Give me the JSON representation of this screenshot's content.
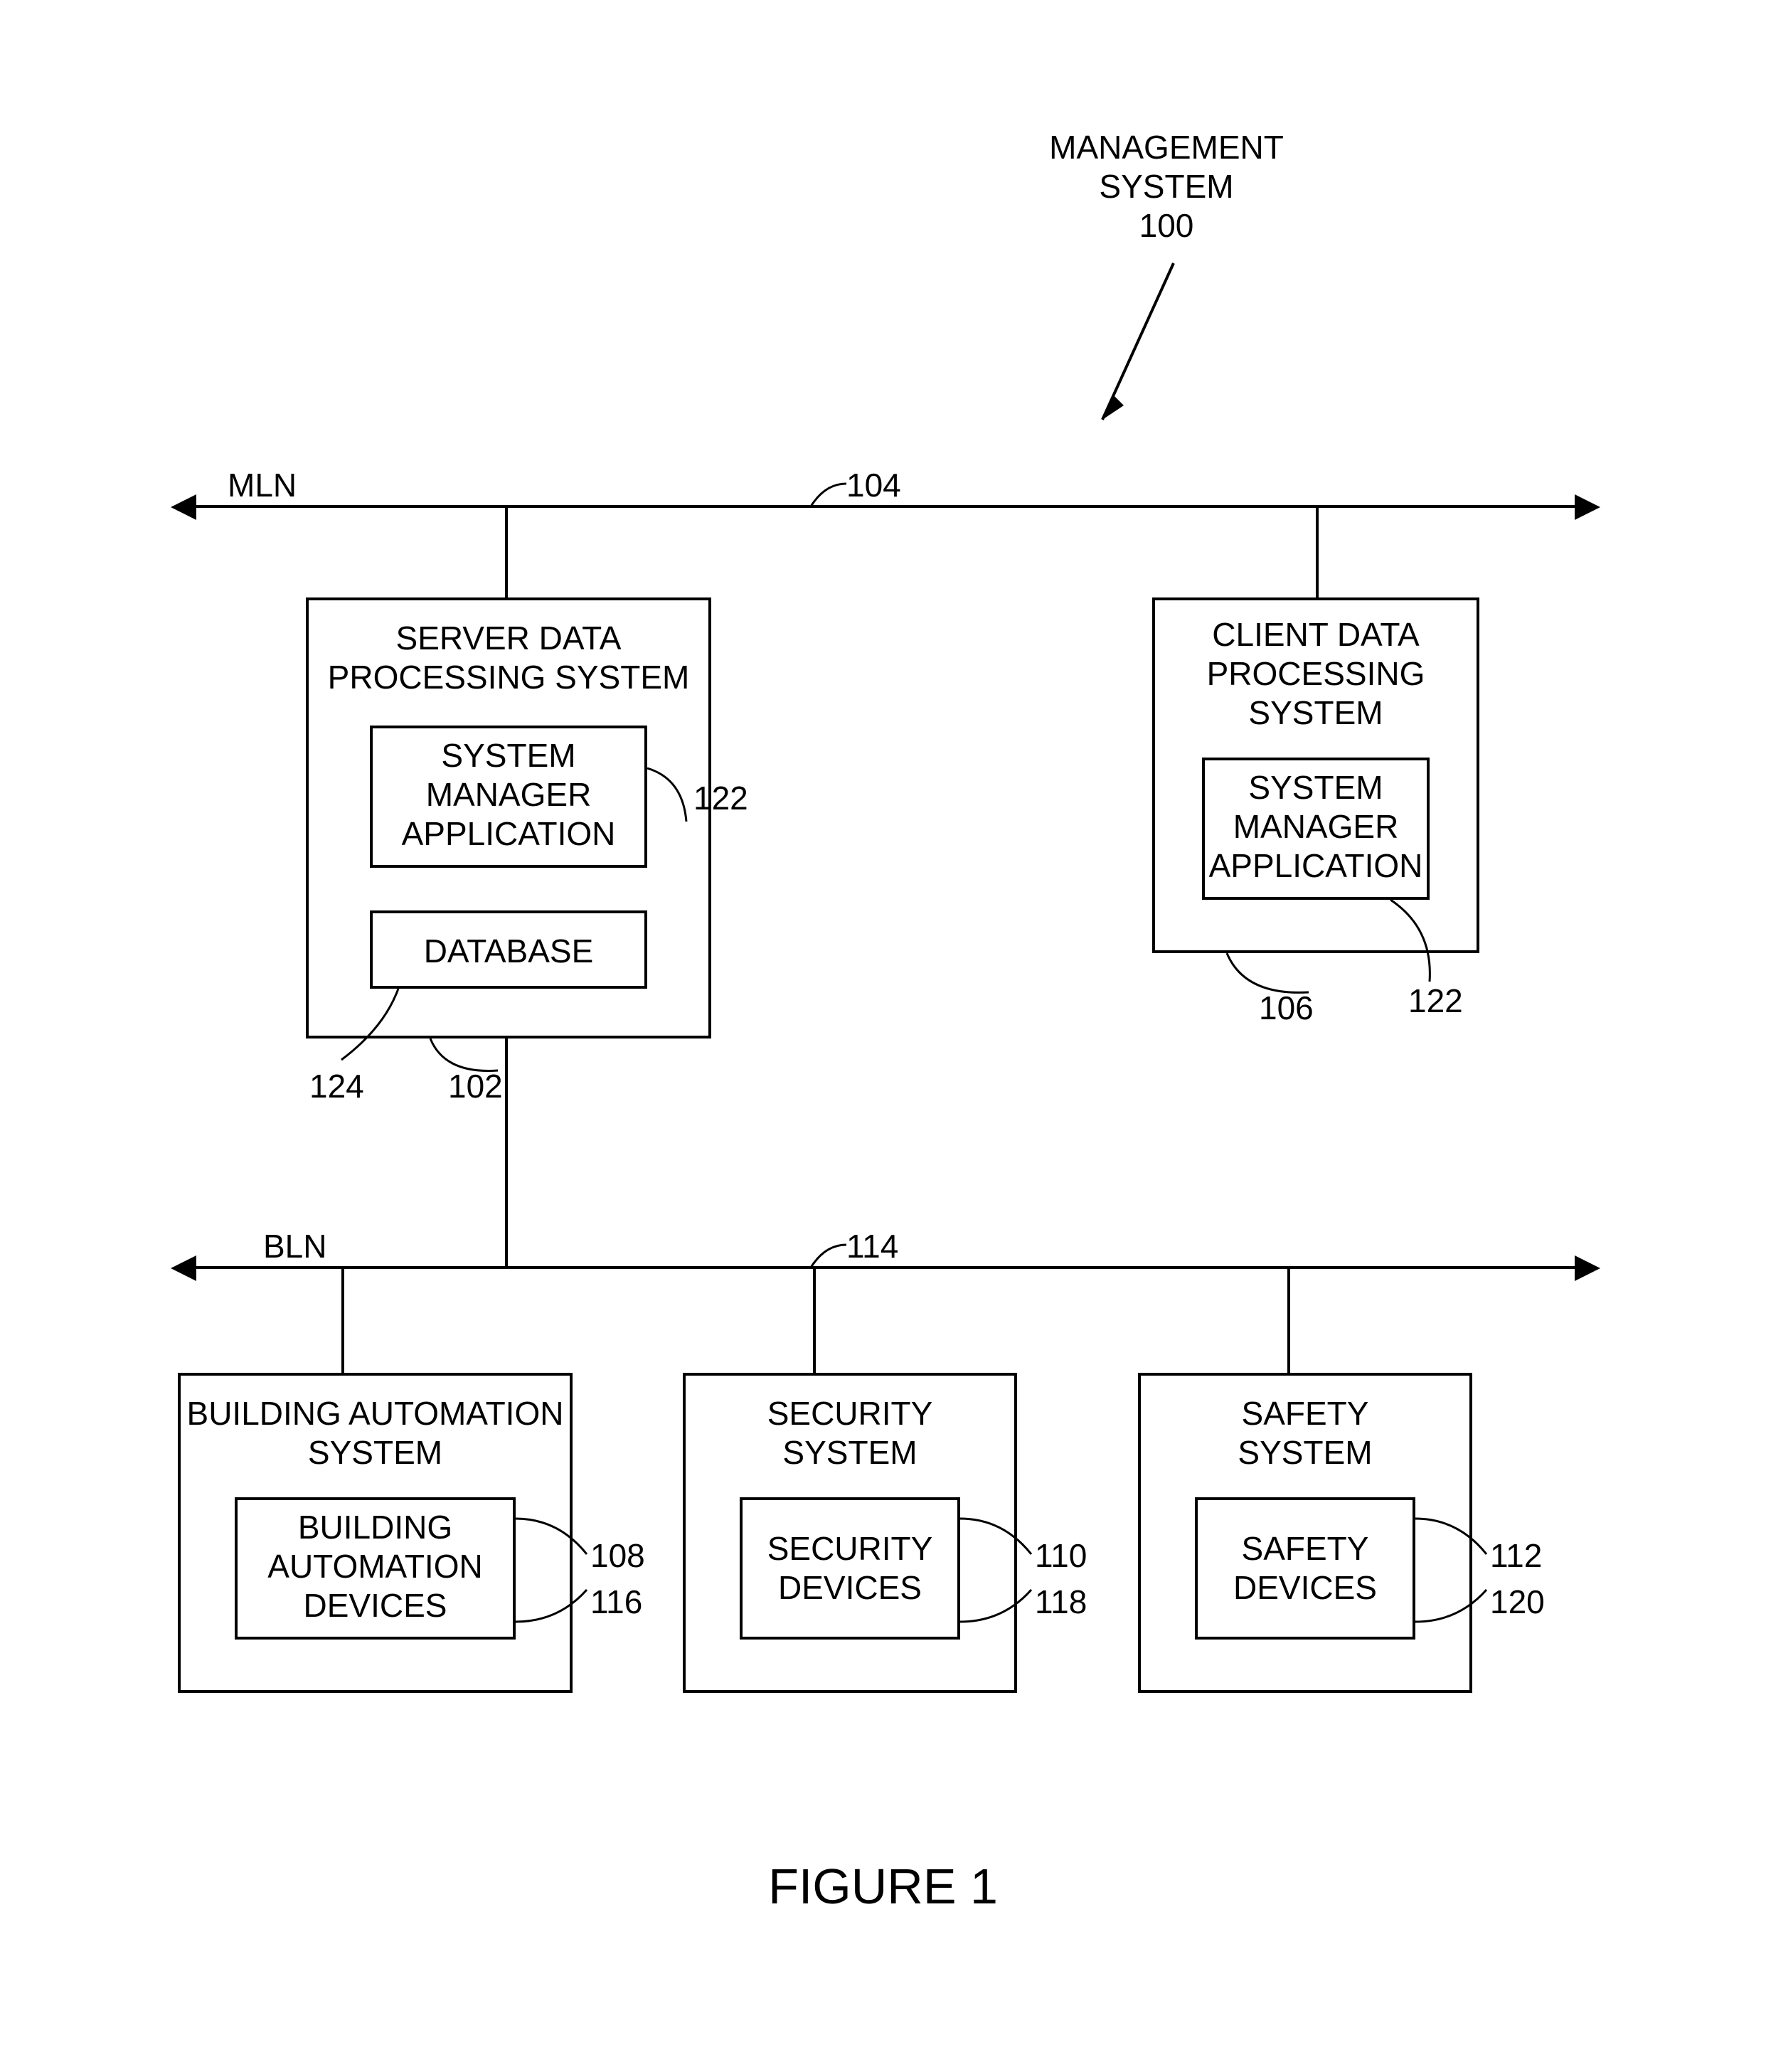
{
  "title": {
    "line1": "MANAGEMENT",
    "line2": "SYSTEM",
    "ref": "100"
  },
  "bus_mln": {
    "label": "MLN",
    "ref": "104"
  },
  "bus_bln": {
    "label": "BLN",
    "ref": "114"
  },
  "server": {
    "title_l1": "SERVER DATA",
    "title_l2": "PROCESSING SYSTEM",
    "app_l1": "SYSTEM",
    "app_l2": "MANAGER",
    "app_l3": "APPLICATION",
    "db": "DATABASE",
    "ref_app": "122",
    "ref_db": "124",
    "ref_box": "102"
  },
  "client": {
    "title_l1": "CLIENT DATA",
    "title_l2": "PROCESSING",
    "title_l3": "SYSTEM",
    "app_l1": "SYSTEM",
    "app_l2": "MANAGER",
    "app_l3": "APPLICATION",
    "ref_app": "122",
    "ref_box": "106"
  },
  "bas": {
    "title_l1": "BUILDING AUTOMATION",
    "title_l2": "SYSTEM",
    "dev_l1": "BUILDING",
    "dev_l2": "AUTOMATION",
    "dev_l3": "DEVICES",
    "ref_box": "108",
    "ref_dev": "116"
  },
  "security": {
    "title_l1": "SECURITY",
    "title_l2": "SYSTEM",
    "dev_l1": "SECURITY",
    "dev_l2": "DEVICES",
    "ref_box": "110",
    "ref_dev": "118"
  },
  "safety": {
    "title_l1": "SAFETY",
    "title_l2": "SYSTEM",
    "dev_l1": "SAFETY",
    "dev_l2": "DEVICES",
    "ref_box": "112",
    "ref_dev": "120"
  },
  "figure_caption": "FIGURE 1"
}
